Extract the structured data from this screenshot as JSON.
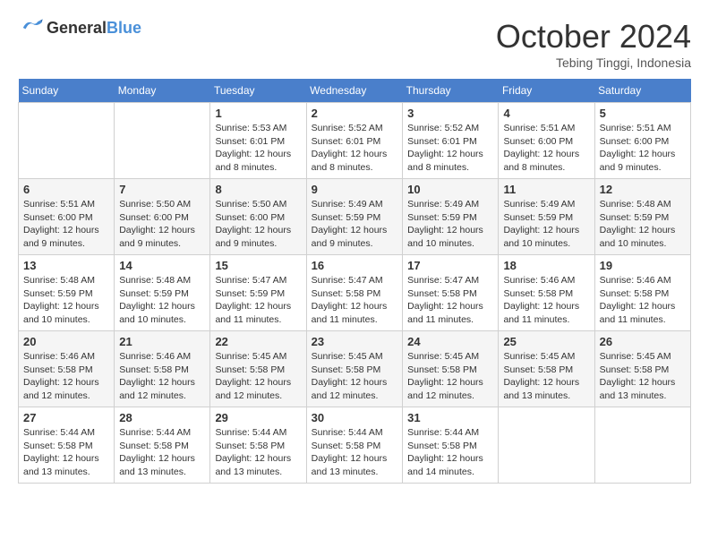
{
  "logo": {
    "general": "General",
    "blue": "Blue"
  },
  "header": {
    "month": "October 2024",
    "location": "Tebing Tinggi, Indonesia"
  },
  "weekdays": [
    "Sunday",
    "Monday",
    "Tuesday",
    "Wednesday",
    "Thursday",
    "Friday",
    "Saturday"
  ],
  "weeks": [
    [
      {
        "day": "",
        "info": ""
      },
      {
        "day": "",
        "info": ""
      },
      {
        "day": "1",
        "info": "Sunrise: 5:53 AM\nSunset: 6:01 PM\nDaylight: 12 hours and 8 minutes."
      },
      {
        "day": "2",
        "info": "Sunrise: 5:52 AM\nSunset: 6:01 PM\nDaylight: 12 hours and 8 minutes."
      },
      {
        "day": "3",
        "info": "Sunrise: 5:52 AM\nSunset: 6:01 PM\nDaylight: 12 hours and 8 minutes."
      },
      {
        "day": "4",
        "info": "Sunrise: 5:51 AM\nSunset: 6:00 PM\nDaylight: 12 hours and 8 minutes."
      },
      {
        "day": "5",
        "info": "Sunrise: 5:51 AM\nSunset: 6:00 PM\nDaylight: 12 hours and 9 minutes."
      }
    ],
    [
      {
        "day": "6",
        "info": "Sunrise: 5:51 AM\nSunset: 6:00 PM\nDaylight: 12 hours and 9 minutes."
      },
      {
        "day": "7",
        "info": "Sunrise: 5:50 AM\nSunset: 6:00 PM\nDaylight: 12 hours and 9 minutes."
      },
      {
        "day": "8",
        "info": "Sunrise: 5:50 AM\nSunset: 6:00 PM\nDaylight: 12 hours and 9 minutes."
      },
      {
        "day": "9",
        "info": "Sunrise: 5:49 AM\nSunset: 5:59 PM\nDaylight: 12 hours and 9 minutes."
      },
      {
        "day": "10",
        "info": "Sunrise: 5:49 AM\nSunset: 5:59 PM\nDaylight: 12 hours and 10 minutes."
      },
      {
        "day": "11",
        "info": "Sunrise: 5:49 AM\nSunset: 5:59 PM\nDaylight: 12 hours and 10 minutes."
      },
      {
        "day": "12",
        "info": "Sunrise: 5:48 AM\nSunset: 5:59 PM\nDaylight: 12 hours and 10 minutes."
      }
    ],
    [
      {
        "day": "13",
        "info": "Sunrise: 5:48 AM\nSunset: 5:59 PM\nDaylight: 12 hours and 10 minutes."
      },
      {
        "day": "14",
        "info": "Sunrise: 5:48 AM\nSunset: 5:59 PM\nDaylight: 12 hours and 10 minutes."
      },
      {
        "day": "15",
        "info": "Sunrise: 5:47 AM\nSunset: 5:59 PM\nDaylight: 12 hours and 11 minutes."
      },
      {
        "day": "16",
        "info": "Sunrise: 5:47 AM\nSunset: 5:58 PM\nDaylight: 12 hours and 11 minutes."
      },
      {
        "day": "17",
        "info": "Sunrise: 5:47 AM\nSunset: 5:58 PM\nDaylight: 12 hours and 11 minutes."
      },
      {
        "day": "18",
        "info": "Sunrise: 5:46 AM\nSunset: 5:58 PM\nDaylight: 12 hours and 11 minutes."
      },
      {
        "day": "19",
        "info": "Sunrise: 5:46 AM\nSunset: 5:58 PM\nDaylight: 12 hours and 11 minutes."
      }
    ],
    [
      {
        "day": "20",
        "info": "Sunrise: 5:46 AM\nSunset: 5:58 PM\nDaylight: 12 hours and 12 minutes."
      },
      {
        "day": "21",
        "info": "Sunrise: 5:46 AM\nSunset: 5:58 PM\nDaylight: 12 hours and 12 minutes."
      },
      {
        "day": "22",
        "info": "Sunrise: 5:45 AM\nSunset: 5:58 PM\nDaylight: 12 hours and 12 minutes."
      },
      {
        "day": "23",
        "info": "Sunrise: 5:45 AM\nSunset: 5:58 PM\nDaylight: 12 hours and 12 minutes."
      },
      {
        "day": "24",
        "info": "Sunrise: 5:45 AM\nSunset: 5:58 PM\nDaylight: 12 hours and 12 minutes."
      },
      {
        "day": "25",
        "info": "Sunrise: 5:45 AM\nSunset: 5:58 PM\nDaylight: 12 hours and 13 minutes."
      },
      {
        "day": "26",
        "info": "Sunrise: 5:45 AM\nSunset: 5:58 PM\nDaylight: 12 hours and 13 minutes."
      }
    ],
    [
      {
        "day": "27",
        "info": "Sunrise: 5:44 AM\nSunset: 5:58 PM\nDaylight: 12 hours and 13 minutes."
      },
      {
        "day": "28",
        "info": "Sunrise: 5:44 AM\nSunset: 5:58 PM\nDaylight: 12 hours and 13 minutes."
      },
      {
        "day": "29",
        "info": "Sunrise: 5:44 AM\nSunset: 5:58 PM\nDaylight: 12 hours and 13 minutes."
      },
      {
        "day": "30",
        "info": "Sunrise: 5:44 AM\nSunset: 5:58 PM\nDaylight: 12 hours and 13 minutes."
      },
      {
        "day": "31",
        "info": "Sunrise: 5:44 AM\nSunset: 5:58 PM\nDaylight: 12 hours and 14 minutes."
      },
      {
        "day": "",
        "info": ""
      },
      {
        "day": "",
        "info": ""
      }
    ]
  ]
}
